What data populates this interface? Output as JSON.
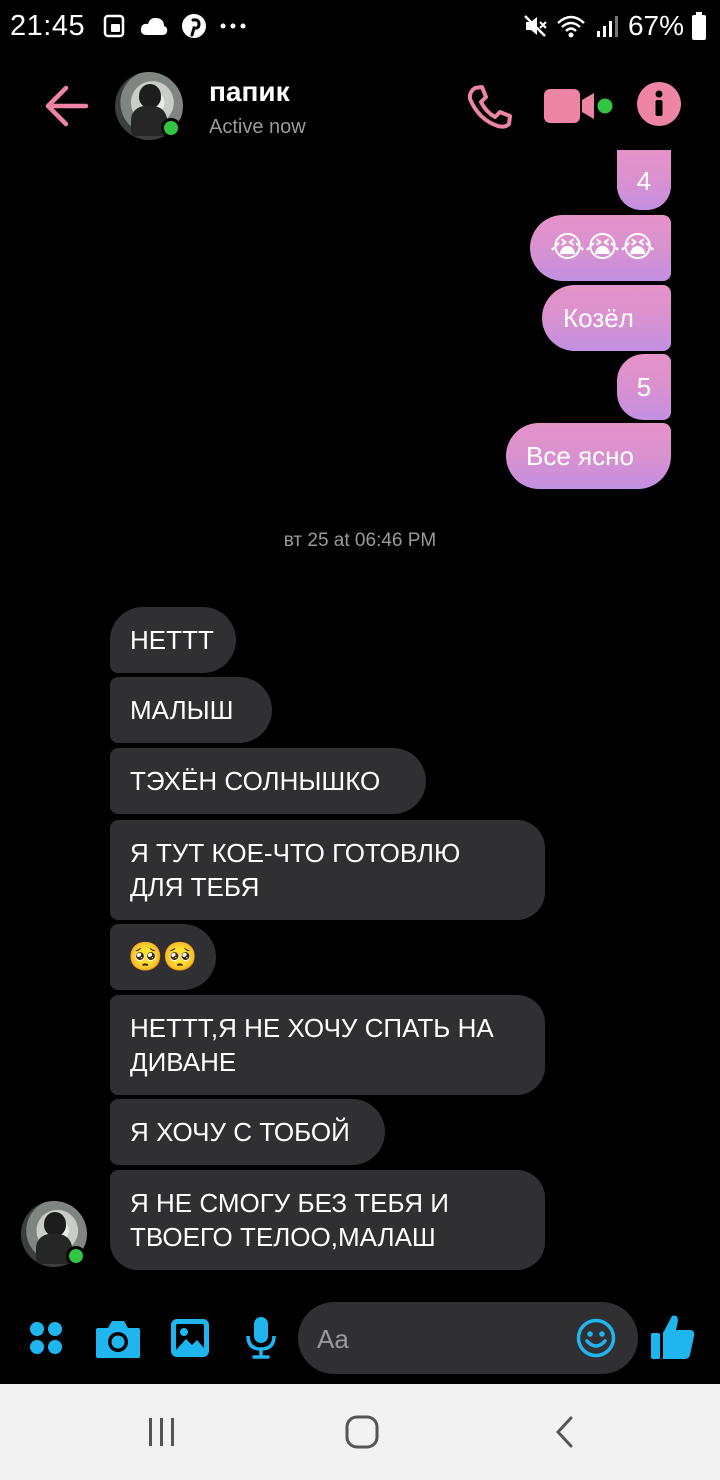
{
  "status_bar": {
    "time": "21:45",
    "battery": "67%",
    "icons": [
      "sim-card-icon",
      "cloud-icon",
      "pinterest-icon",
      "more-icon",
      "mute-icon",
      "wifi-icon",
      "signal-icon",
      "battery-icon"
    ]
  },
  "header": {
    "contact_name": "папик",
    "status": "Active now",
    "accent_color": "#ef85a6",
    "online_color": "#32c544"
  },
  "messages_outgoing": [
    {
      "text": "4"
    },
    {
      "text": "😭😭😭"
    },
    {
      "text": "Козёл"
    },
    {
      "text": "5"
    },
    {
      "text": "Все ясно"
    }
  ],
  "timestamp": "вт 25 at 06:46 PM",
  "messages_incoming": [
    {
      "text": "НЕТТТ"
    },
    {
      "text": "МАЛЫШ"
    },
    {
      "text": "ТЭХЁН СОЛНЫШКО"
    },
    {
      "line1": "Я ТУТ КОЕ-ЧТО ГОТОВЛЮ",
      "line2": "ДЛЯ ТЕБЯ"
    },
    {
      "text": "🥺🥺"
    },
    {
      "line1": "НЕТТТ,Я НЕ ХОЧУ СПАТЬ НА",
      "line2": "ДИВАНЕ"
    },
    {
      "text": "Я ХОЧУ С ТОБОЙ"
    },
    {
      "line1": "Я НЕ СМОГУ БЕЗ ТЕБЯ И",
      "line2": "ТВОЕГО ТЕЛОО,МАЛАШ"
    }
  ],
  "composer": {
    "placeholder": "Aa",
    "accent_color": "#1fb6f0"
  }
}
